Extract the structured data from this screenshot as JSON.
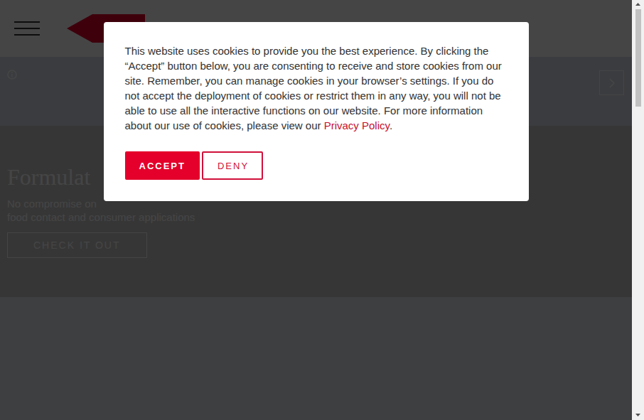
{
  "hero": {
    "title": "Formulat",
    "subtitle": [
      "No compromise on",
      "food contact and consumer applications"
    ],
    "button": "CHECK IT OUT"
  },
  "cookie_dialog": {
    "text": "This website uses cookies to provide you the best experience. By clicking the “Accept” button below, you are consenting to receive and store cookies from our site. Remember, you can manage cookies in your browser’s settings. If you do not accept the deployment of cookies or restrict them in any way, you will not be able to use all the interactive functions on our website. For more information about our use of cookies, please view our ",
    "link": "Privacy Policy",
    "text_after_link": ".",
    "buttons": [
      {
        "label": "ACCEPT",
        "kind": "filled"
      },
      {
        "label": "DENY",
        "kind": "outline"
      }
    ]
  }
}
